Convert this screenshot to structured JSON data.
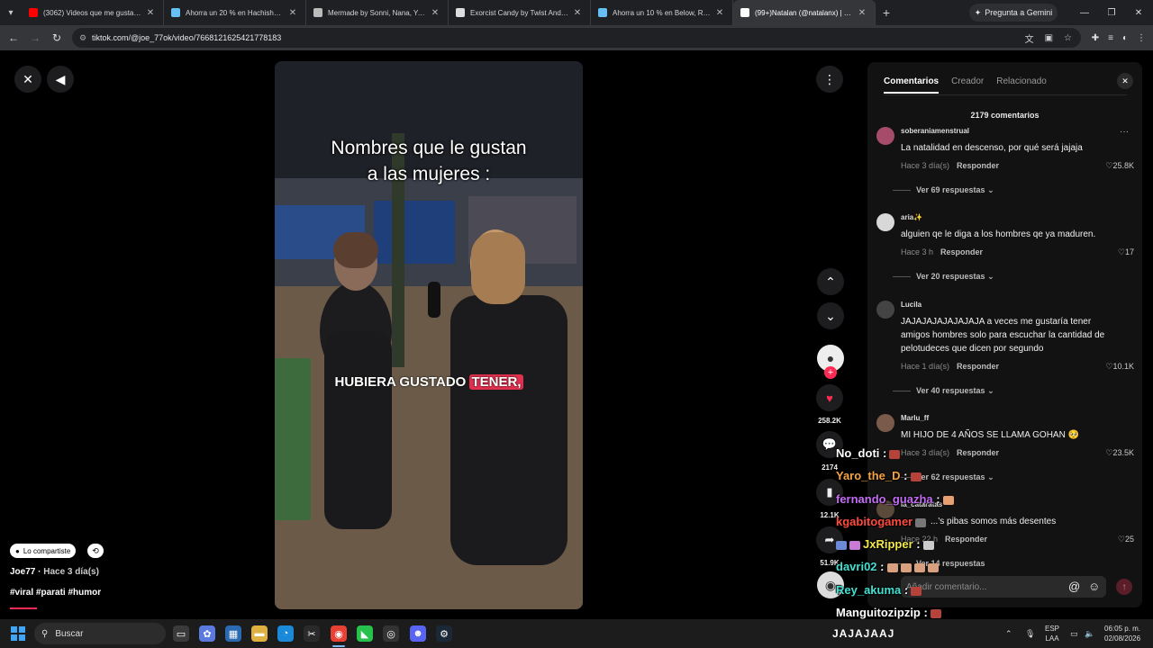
{
  "browser": {
    "tabs": [
      {
        "title": "(3062) Videos que me gustan -",
        "favicon_color": "#ff0000",
        "active": false
      },
      {
        "title": "Ahorra un 20 % en Hachishakus",
        "favicon_color": "#66c0f4",
        "active": false
      },
      {
        "title": "Mermade by Sonni, Nana, Yeup",
        "favicon_color": "#bbbbbb",
        "active": false
      },
      {
        "title": "Exorcist Candy by Twist And Sc",
        "favicon_color": "#dddddd",
        "active": false
      },
      {
        "title": "Ahorra un 10 % en Below, Rust",
        "favicon_color": "#66c0f4",
        "active": false
      },
      {
        "title": "(99+)Natalan (@natalanx) | Tik",
        "favicon_color": "#ffffff",
        "active": true
      }
    ],
    "gemini_label": "Pregunta a Gemini",
    "url": "tiktok.com/@joe_77ok/video/7668121625421778183"
  },
  "video": {
    "title_line1": "Nombres que le gustan",
    "title_line2": "a las mujeres :",
    "caption_plain": "HUBIERA GUSTADO ",
    "caption_highlight": "TENER,"
  },
  "actions": {
    "likes": "258.2K",
    "comments": "2174",
    "saves": "12.1K",
    "shares": "51.9K"
  },
  "post": {
    "shared_label": "Lo compartiste",
    "author": "Joe77",
    "posted": "Hace 3 día(s)",
    "hashtags": "#viral #parati #humor"
  },
  "panel": {
    "tabs": [
      "Comentarios",
      "Creador",
      "Relacionado"
    ],
    "comment_count": "2179 comentarios",
    "reply_label": "Responder",
    "input_placeholder": "Añadir comentario...",
    "comments": [
      {
        "user": "soberaniamenstrual",
        "text": "La natalidad en descenso, por qué será jajaja",
        "time": "Hace 3 día(s)",
        "likes": "25.8K",
        "replies": "Ver 69 respuestas",
        "avatar_color": "#a64b6a"
      },
      {
        "user": "aria✨",
        "text": "alguien qe le diga a los hombres qe ya maduren.",
        "time": "Hace 3 h",
        "likes": "17",
        "replies": "Ver 20 respuestas",
        "avatar_color": "#d8d8d8"
      },
      {
        "user": "Lucila",
        "text": "JAJAJAJAJAJAJAJA a veces me gustaría tener amigos hombres solo para escuchar la cantidad de pelotudeces que dicen por segundo",
        "time": "Hace 1 día(s)",
        "likes": "10.1K",
        "replies": "Ver 40 respuestas",
        "avatar_color": "#444444"
      },
      {
        "user": "Marlu_ff",
        "text": "MI HIJO DE 4 AÑOS SE LLAMA GOHAN 🥺",
        "time": "Hace 3 día(s)",
        "likes": "23.5K",
        "replies": "Ver 62 respuestas",
        "avatar_color": "#7a5a4a"
      },
      {
        "user": "la_cataratas",
        "text": "...'s pibas somos más desentes",
        "time": "Hace 22 h",
        "likes": "25",
        "replies": "Ver 14 respuestas",
        "avatar_color": "#5a4a3a"
      }
    ]
  },
  "chat": {
    "lines": [
      {
        "user": "No_doti",
        "color": "#ffffff"
      },
      {
        "user": "Yaro_the_D",
        "color": "#f4a340"
      },
      {
        "user": "fernando_guazha",
        "color": "#c46cf5"
      },
      {
        "user": "kgabitogamer",
        "color": "#ff4b3e"
      },
      {
        "user": "JxRipper",
        "color": "#f2e94e"
      },
      {
        "user": "davri02",
        "color": "#44e0d2"
      },
      {
        "user": "Rey_akuma",
        "color": "#44e0d2"
      },
      {
        "user": "Manguitozipzip",
        "color": "#ffffff"
      }
    ],
    "bottom_text": "JAJAJAAJ"
  },
  "taskbar": {
    "search_label": "Buscar",
    "lang_line1": "ESP",
    "lang_line2": "LAA",
    "time": "06:05 p. m.",
    "date": "02/08/2026"
  }
}
